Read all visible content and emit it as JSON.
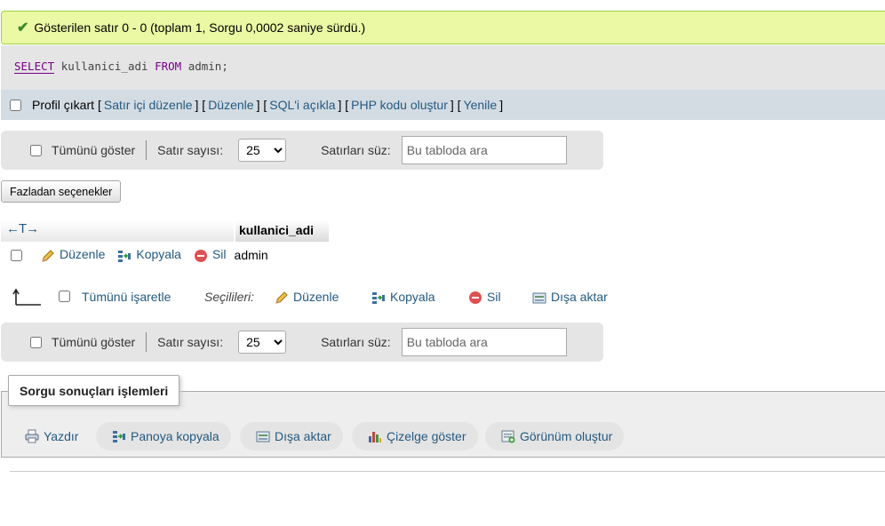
{
  "message": {
    "text": "Gösterilen satır 0 - 0 (toplam 1, Sorgu 0,0002 saniye sürdü.)",
    "icon": "check-icon",
    "color": "#ebf8a4"
  },
  "sql": {
    "kw1": "SELECT",
    "part1": "kullanici_adi",
    "kw2": "FROM",
    "part2": "admin;"
  },
  "toolbar": {
    "profile": "Profil çıkart",
    "bl": "[",
    "br": "]",
    "links": [
      "Satır içi düzenle",
      "Düzenle",
      "SQL'i açıkla",
      "PHP kodu oluştur",
      "Yenile"
    ]
  },
  "nav": {
    "show_all": "Tümünü göster",
    "rows_label": "Satır sayısı:",
    "rows_value": "25",
    "filter_label": "Satırları süz:",
    "search_placeholder": "Bu tabloda ara"
  },
  "more_options": "Fazladan seçenekler",
  "table": {
    "arrows": "←T→",
    "columns": [
      "kullanici_adi"
    ],
    "rows": [
      {
        "edit": "Düzenle",
        "copy": "Kopyala",
        "delete": "Sil",
        "kullanici_adi": "admin"
      }
    ]
  },
  "with_selected": {
    "check_all": "Tümünü işaretle",
    "label": "Seçilileri:",
    "edit": "Düzenle",
    "copy": "Kopyala",
    "delete": "Sil",
    "export": "Dışa aktar"
  },
  "operations": {
    "legend": "Sorgu sonuçları işlemleri",
    "print": "Yazdır",
    "copy_clipboard": "Panoya kopyala",
    "export": "Dışa aktar",
    "chart": "Çizelge göster",
    "create_view": "Görünüm oluştur"
  }
}
